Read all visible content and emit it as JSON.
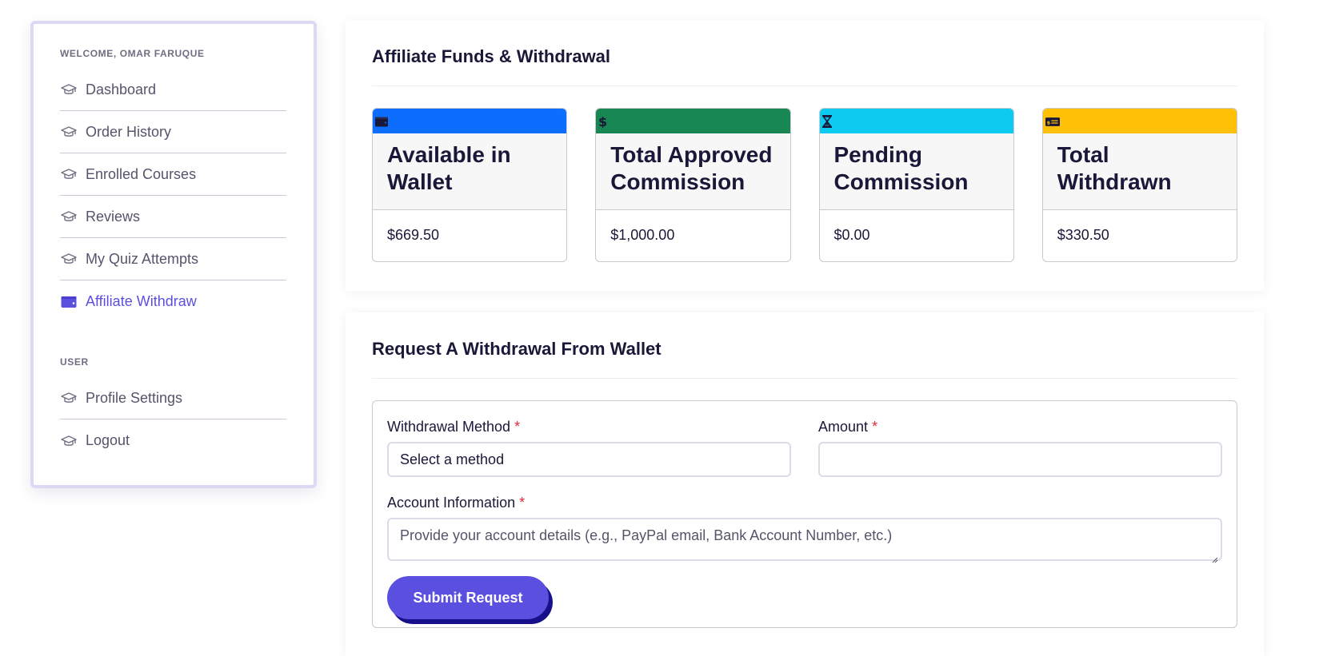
{
  "sidebar": {
    "welcome_label": "WELCOME, OMAR FARUQUE",
    "items": [
      {
        "label": "Dashboard",
        "icon": "graduation-cap-icon"
      },
      {
        "label": "Order History",
        "icon": "graduation-cap-icon"
      },
      {
        "label": "Enrolled Courses",
        "icon": "graduation-cap-icon"
      },
      {
        "label": "Reviews",
        "icon": "graduation-cap-icon"
      },
      {
        "label": "My Quiz Attempts",
        "icon": "graduation-cap-icon"
      },
      {
        "label": "Affiliate Withdraw",
        "icon": "wallet-icon",
        "active": true
      }
    ],
    "user_label": "USER",
    "user_items": [
      {
        "label": "Profile Settings",
        "icon": "graduation-cap-icon"
      },
      {
        "label": "Logout",
        "icon": "graduation-cap-icon"
      }
    ]
  },
  "funds": {
    "title": "Affiliate Funds & Withdrawal",
    "cards": [
      {
        "title": "Available in Wallet",
        "value": "$669.50",
        "color": "#0d6efd",
        "icon": "wallet-icon"
      },
      {
        "title": "Total Approved Commission",
        "value": "$1,000.00",
        "color": "#198754",
        "icon": "dollar-icon"
      },
      {
        "title": "Pending Commission",
        "value": "$0.00",
        "color": "#0dcaf0",
        "icon": "hourglass-icon"
      },
      {
        "title": "Total Withdrawn",
        "value": "$330.50",
        "color": "#ffc107",
        "icon": "money-check-icon"
      }
    ]
  },
  "request": {
    "title": "Request A Withdrawal From Wallet",
    "method_label": "Withdrawal Method",
    "method_value": "Select a method",
    "amount_label": "Amount",
    "amount_value": "",
    "account_label": "Account Information",
    "account_placeholder": "Provide your account details (e.g., PayPal email, Bank Account Number, etc.)",
    "required_mark": "*",
    "submit_label": "Submit Request"
  },
  "colors": {
    "accent": "#5b4fe0",
    "accent_shadow": "#17108a",
    "required": "#e0283c"
  }
}
